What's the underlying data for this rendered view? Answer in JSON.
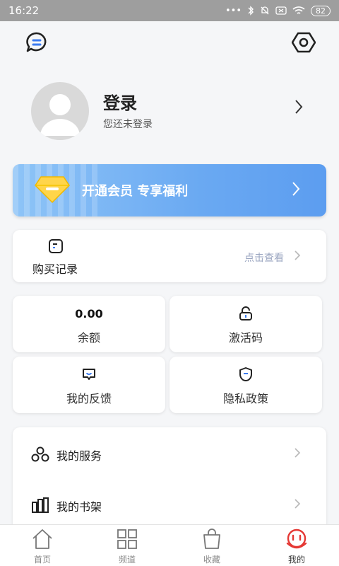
{
  "status_bar": {
    "time": "16:22",
    "battery": "82"
  },
  "profile": {
    "title": "登录",
    "subtitle": "您还未登录"
  },
  "vip_banner": {
    "label": "开通会员 专享福利"
  },
  "purchase": {
    "label": "购买记录",
    "hint": "点击查看"
  },
  "tiles": {
    "balance_value": "0.00",
    "balance_label": "余额",
    "activation_label": "激活码",
    "feedback_label": "我的反馈",
    "privacy_label": "隐私政策"
  },
  "menu": {
    "services_label": "我的服务",
    "bookshelf_label": "我的书架"
  },
  "tabbar": {
    "home": "首页",
    "channels": "频道",
    "favorites": "收藏",
    "mine": "我的"
  },
  "colors": {
    "accent": "#e53935",
    "vip_gradient_start": "#8ec4f7",
    "vip_gradient_end": "#5c9df0",
    "hint": "#9aa5c0"
  },
  "icons": [
    "chat-icon",
    "settings-hex-icon",
    "avatar-placeholder",
    "chevron-right-icon",
    "diamond-icon",
    "document-icon",
    "lock-icon",
    "feedback-icon",
    "shield-icon",
    "services-icon",
    "bookshelf-icon",
    "home-icon",
    "grid-icon",
    "bag-icon",
    "mine-face-icon"
  ]
}
